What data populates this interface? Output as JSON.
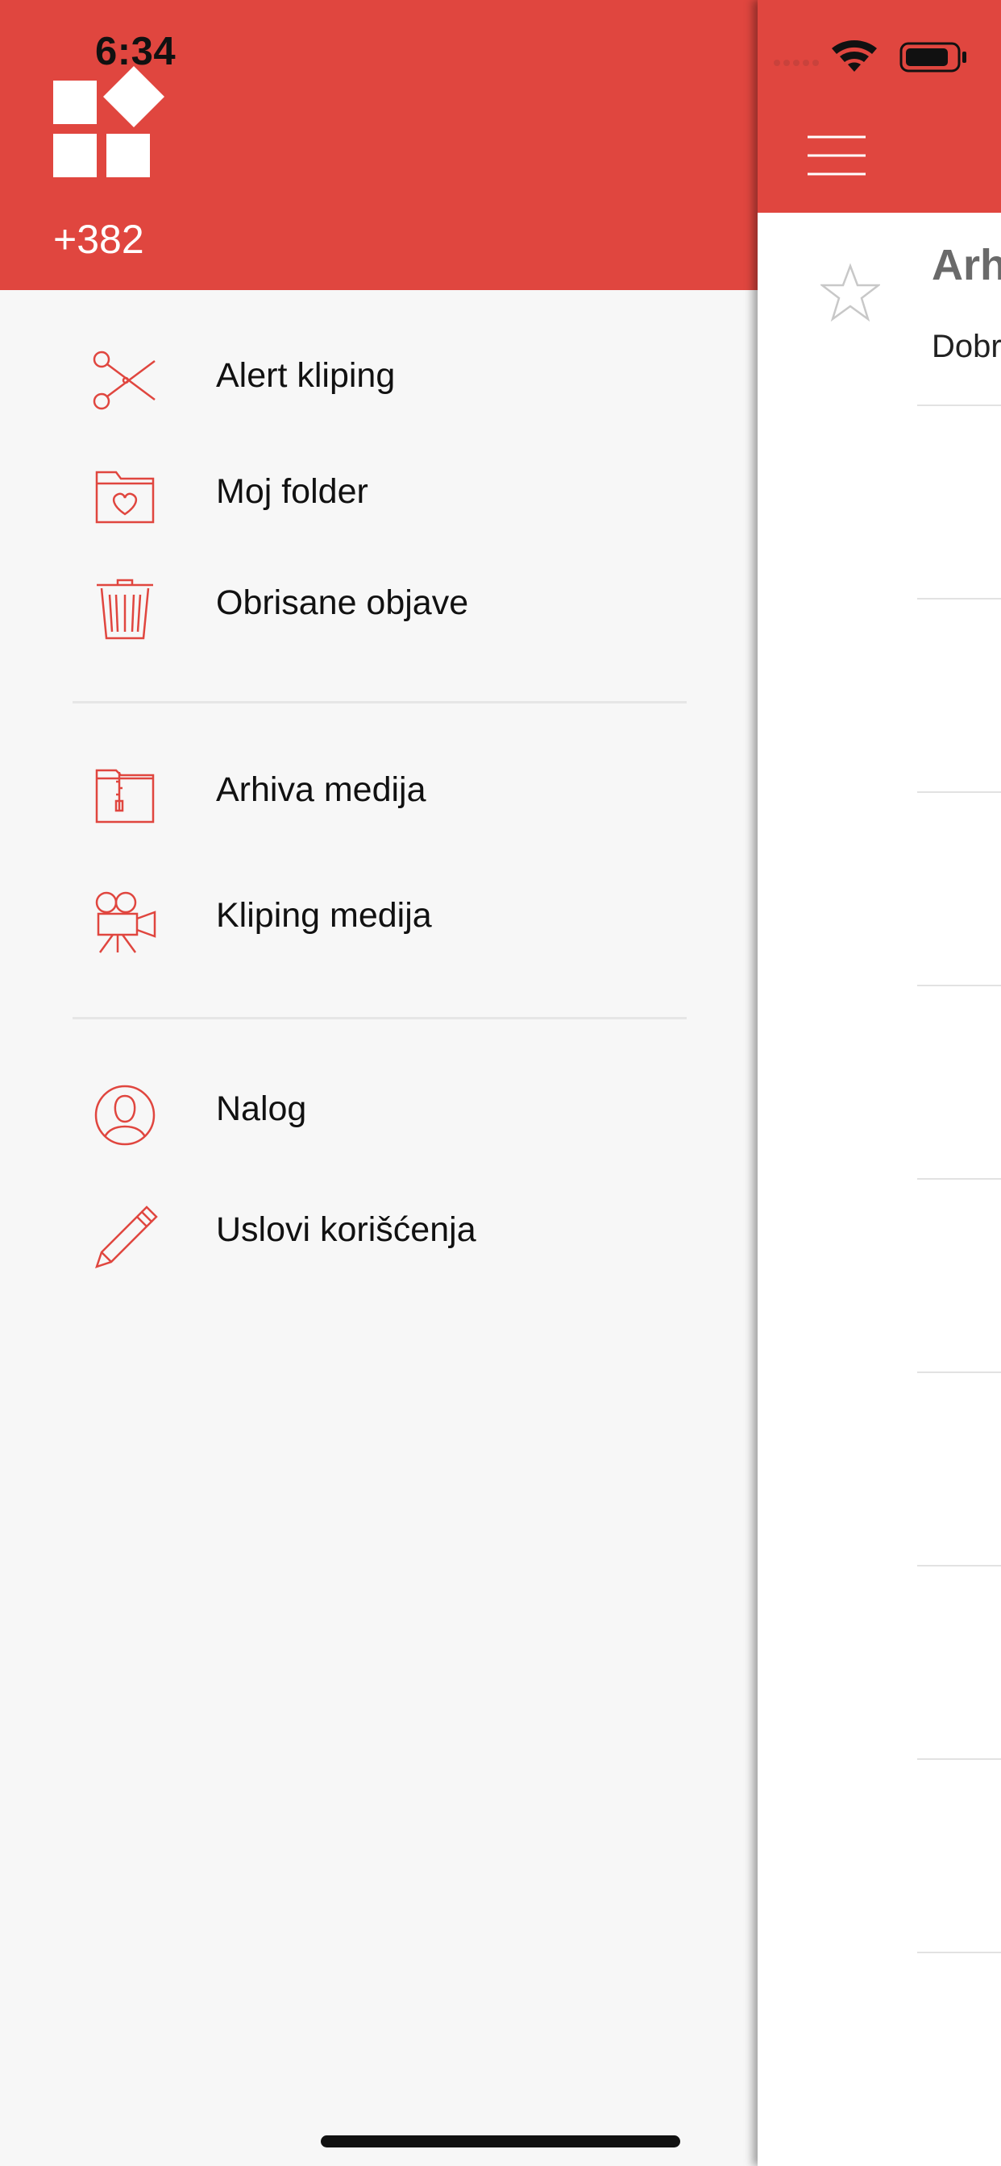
{
  "status_bar": {
    "time": "6:34"
  },
  "drawer": {
    "phone": "+382",
    "menu_groups": [
      [
        {
          "name": "alert-kliping",
          "icon": "scissors-icon",
          "label": "Alert kliping"
        },
        {
          "name": "moj-folder",
          "icon": "folder-heart-icon",
          "label": "Moj folder"
        },
        {
          "name": "obrisane-objave",
          "icon": "trash-icon",
          "label": "Obrisane objave"
        }
      ],
      [
        {
          "name": "arhiva-medija",
          "icon": "archive-folder-icon",
          "label": "Arhiva medija"
        },
        {
          "name": "kliping-medija",
          "icon": "video-camera-icon",
          "label": "Kliping medija"
        }
      ],
      [
        {
          "name": "nalog",
          "icon": "user-icon",
          "label": "Nalog"
        },
        {
          "name": "uslovi-koriscenja",
          "icon": "pen-icon",
          "label": "Uslovi korišćenja"
        }
      ]
    ]
  },
  "main": {
    "list": [
      {
        "title": "Arh",
        "subtitle": "Dobr"
      }
    ]
  },
  "colors": {
    "brand": "#e0463f",
    "drawer_bg": "#f7f7f7",
    "icon_stroke": "#e0463f"
  }
}
